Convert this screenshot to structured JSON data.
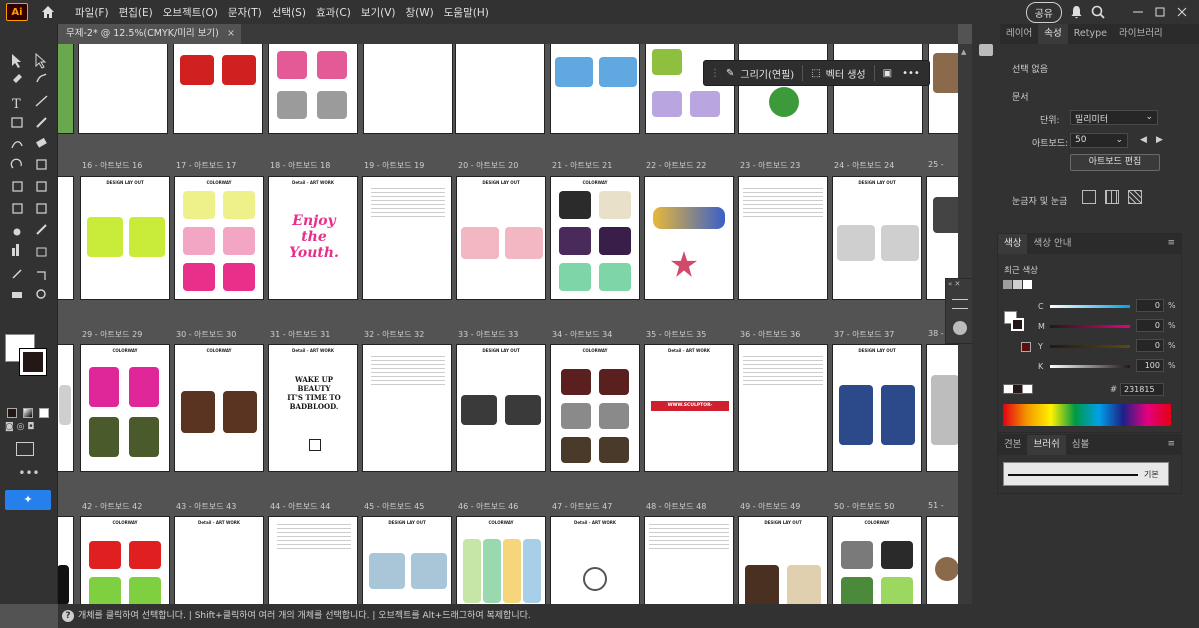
{
  "app": {
    "logo": "Ai"
  },
  "menu": [
    "파일(F)",
    "편집(E)",
    "오브젝트(O)",
    "문자(T)",
    "선택(S)",
    "효과(C)",
    "보기(V)",
    "창(W)",
    "도움말(H)"
  ],
  "topbar": {
    "share_label": "공유"
  },
  "document": {
    "tab_title": "무제-2* @ 12.5%(CMYK/미리 보기)",
    "close": "×"
  },
  "context_bar": {
    "draw_label": "그리기(연필)",
    "vector_label": "벡터 생성",
    "more": "•••"
  },
  "artboards": {
    "row1": [
      "16 - 아트보드 16",
      "17 - 아트보드 17",
      "18 - 아트보드 18",
      "19 - 아트보드 19",
      "20 - 아트보드 20",
      "21 - 아트보드 21",
      "22 - 아트보드 22",
      "23 - 아트보드 23",
      "24 - 아트보드 24",
      "25 - "
    ],
    "row2": [
      "29 - 아트보드 29",
      "30 - 아트보드 30",
      "31 - 아트보드 31",
      "32 - 아트보드 32",
      "33 - 아트보드 33",
      "34 - 아트보드 34",
      "35 - 아트보드 35",
      "36 - 아트보드 36",
      "37 - 아트보드 37",
      "38 - "
    ],
    "row3": [
      "42 - 아트보드 42",
      "43 - 아트보드 43",
      "44 - 아트보드 44",
      "45 - 아트보드 45",
      "46 - 아트보드 46",
      "47 - 아트보드 47",
      "48 - 아트보드 48",
      "49 - 아트보드 49",
      "50 - 아트보드 50",
      "51 - "
    ],
    "headers": {
      "design": "DESIGN LAY OUT",
      "colorway": "COLORWAY",
      "detail": "Detail - ART WORK"
    },
    "art_text": {
      "wakeup": "WAKE UP\nBEAUTY\nIT'S TIME TO\nBADBLOOD.",
      "url": "WWW.SCULPTOR-WORLDWIDE.COM",
      "enjoy": "Enjoy the Youth."
    }
  },
  "properties": {
    "tabs": [
      "레이어",
      "속성",
      "Retype",
      "라이브러리"
    ],
    "no_selection": "선택 없음",
    "document_label": "문서",
    "unit_label": "단위:",
    "unit_value": "밀리미터",
    "artboard_label": "아트보드:",
    "artboard_value": "50",
    "edit_artboard": "아트보드 편집",
    "rulers_label": "눈금자 및 눈금"
  },
  "color_panel": {
    "tabs": [
      "색상",
      "색상 안내"
    ],
    "recent": "최근 색상",
    "channels": [
      {
        "name": "C",
        "value": "0",
        "unit": "%"
      },
      {
        "name": "M",
        "value": "0",
        "unit": "%"
      },
      {
        "name": "Y",
        "value": "0",
        "unit": "%"
      },
      {
        "name": "K",
        "value": "100",
        "unit": "%"
      }
    ],
    "hex_label": "#",
    "hex_value": "231815"
  },
  "brush_panel": {
    "tabs": [
      "견본",
      "브러쉬",
      "심볼"
    ],
    "basic": "기본"
  },
  "status": {
    "help_icon": "?",
    "text": "개체를 클릭하여 선택합니다. | Shift+클릭하여 여러 개의 개체를 선택합니다. | 오브젝트를 Alt+드래그하여 복제합니다."
  },
  "colors": {
    "accent": "#2680eb",
    "chrome": "#323232",
    "canvas": "#535353",
    "ai_orange": "#ff9a00"
  }
}
